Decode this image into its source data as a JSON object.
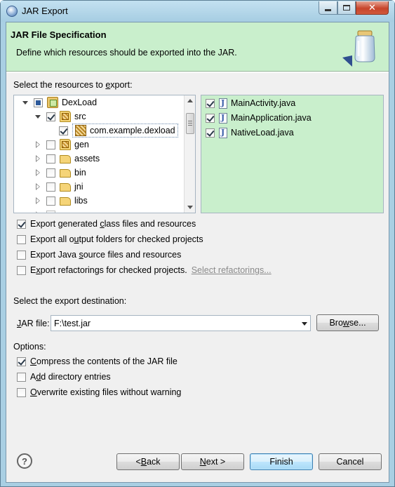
{
  "window": {
    "title": "JAR Export"
  },
  "banner": {
    "title": "JAR File Specification",
    "description": "Define which resources should be exported into the JAR."
  },
  "resources": {
    "label_pre": "Select the resources to ",
    "label_key": "e",
    "label_post": "xport:",
    "tree": [
      {
        "label": "DexLoad",
        "state": "partial",
        "icon": "project-icon",
        "expanded": true,
        "level": 0
      },
      {
        "label": "src",
        "state": "checked",
        "icon": "source-folder-icon",
        "expanded": true,
        "level": 1
      },
      {
        "label": "com.example.dexload",
        "state": "checked",
        "icon": "package-icon",
        "level": 2,
        "selected": true
      },
      {
        "label": "gen",
        "state": "unchecked",
        "icon": "source-folder-icon",
        "expanded": false,
        "level": 1
      },
      {
        "label": "assets",
        "state": "unchecked",
        "icon": "folder-icon",
        "expanded": false,
        "level": 1
      },
      {
        "label": "bin",
        "state": "unchecked",
        "icon": "folder-icon",
        "expanded": false,
        "level": 1
      },
      {
        "label": "jni",
        "state": "unchecked",
        "icon": "folder-icon",
        "expanded": false,
        "level": 1
      },
      {
        "label": "libs",
        "state": "unchecked",
        "icon": "folder-icon",
        "expanded": false,
        "level": 1
      }
    ],
    "files": [
      {
        "label": "MainActivity.java",
        "checked": true
      },
      {
        "label": "MainApplication.java",
        "checked": true
      },
      {
        "label": "NativeLoad.java",
        "checked": true
      }
    ]
  },
  "export_options": [
    {
      "pre": "Export generated ",
      "key": "c",
      "post": "lass files and resources",
      "checked": true
    },
    {
      "pre": "Export all o",
      "key": "u",
      "post": "tput folders for checked projects",
      "checked": false
    },
    {
      "pre": "Export Java ",
      "key": "s",
      "post": "ource files and resources",
      "checked": false
    },
    {
      "pre": "E",
      "key": "x",
      "post": "port refactorings for checked projects.",
      "checked": false
    }
  ],
  "select_refactorings_link": "Select refactorings...",
  "destination": {
    "label": "Select the export destination:",
    "jar_label_key": "J",
    "jar_label_post": "AR file:",
    "jar_value": "F:\\test.jar",
    "browse_pre": "Bro",
    "browse_key": "w",
    "browse_post": "se..."
  },
  "options": {
    "label": "Options:",
    "items": [
      {
        "pre": "",
        "key": "C",
        "post": "ompress the contents of the JAR file",
        "checked": true
      },
      {
        "pre": "A",
        "key": "d",
        "post": "d directory entries",
        "checked": false
      },
      {
        "pre": "",
        "key": "O",
        "post": "verwrite existing files without warning",
        "checked": false
      }
    ]
  },
  "buttons": {
    "back_pre": "< ",
    "back_key": "B",
    "back_post": "ack",
    "next_key": "N",
    "next_post": "ext >",
    "finish": "Finish",
    "cancel": "Cancel"
  },
  "help_glyph": "?",
  "colors": {
    "banner_bg": "#c9efcc",
    "list_bg": "#c9efcc",
    "window_frame": "#a9cfe3"
  }
}
